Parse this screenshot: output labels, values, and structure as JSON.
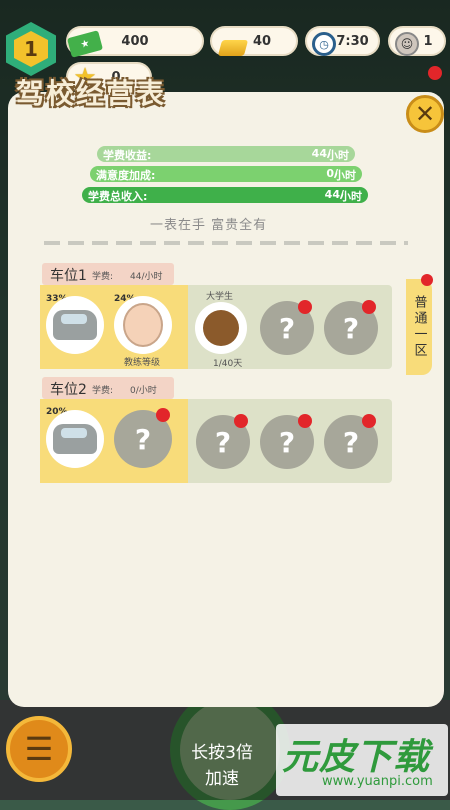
{
  "hud": {
    "level": "1",
    "money": "400",
    "gold": "40",
    "time": "7:30",
    "users": "1",
    "stars": "0",
    "icons": {
      "money": "cash-icon",
      "gold": "gold-bar-icon",
      "time": "clock-icon",
      "user": "avatar-icon",
      "star": "star-icon"
    }
  },
  "panel": {
    "title": "驾校经营表",
    "stats": {
      "fee_label": "学费收益:",
      "fee_value": "44/",
      "fee_unit": "小时",
      "sat_label": "满意度加成:",
      "sat_value": "0/",
      "sat_unit": "小时",
      "total_label": "学费总收入:",
      "total_value": "44/",
      "total_unit": "小时"
    },
    "motto": "一表在手 富贵全有",
    "side_tab": "普通一区",
    "slots": [
      {
        "name": "车位1",
        "fee_label": "学费:",
        "fee_value": "44/小时",
        "car_pct": "33%",
        "coach_pct": "24%",
        "coach_label": "教练等级",
        "student_label": "大学生",
        "student_progress": "1/40天"
      },
      {
        "name": "车位2",
        "fee_label": "学费:",
        "fee_value": "0/小时",
        "car_pct": "20%"
      }
    ],
    "unknown_mark": "?"
  },
  "bottom": {
    "speed_line1": "长按3倍",
    "speed_line2": "加速"
  },
  "watermark": {
    "brand": "元皮下载",
    "url": "www.yuanpi.com"
  },
  "colors": {
    "accent_green": "#3fb04a",
    "accent_yellow": "#f8dc7a",
    "alert_red": "#e2262a"
  }
}
